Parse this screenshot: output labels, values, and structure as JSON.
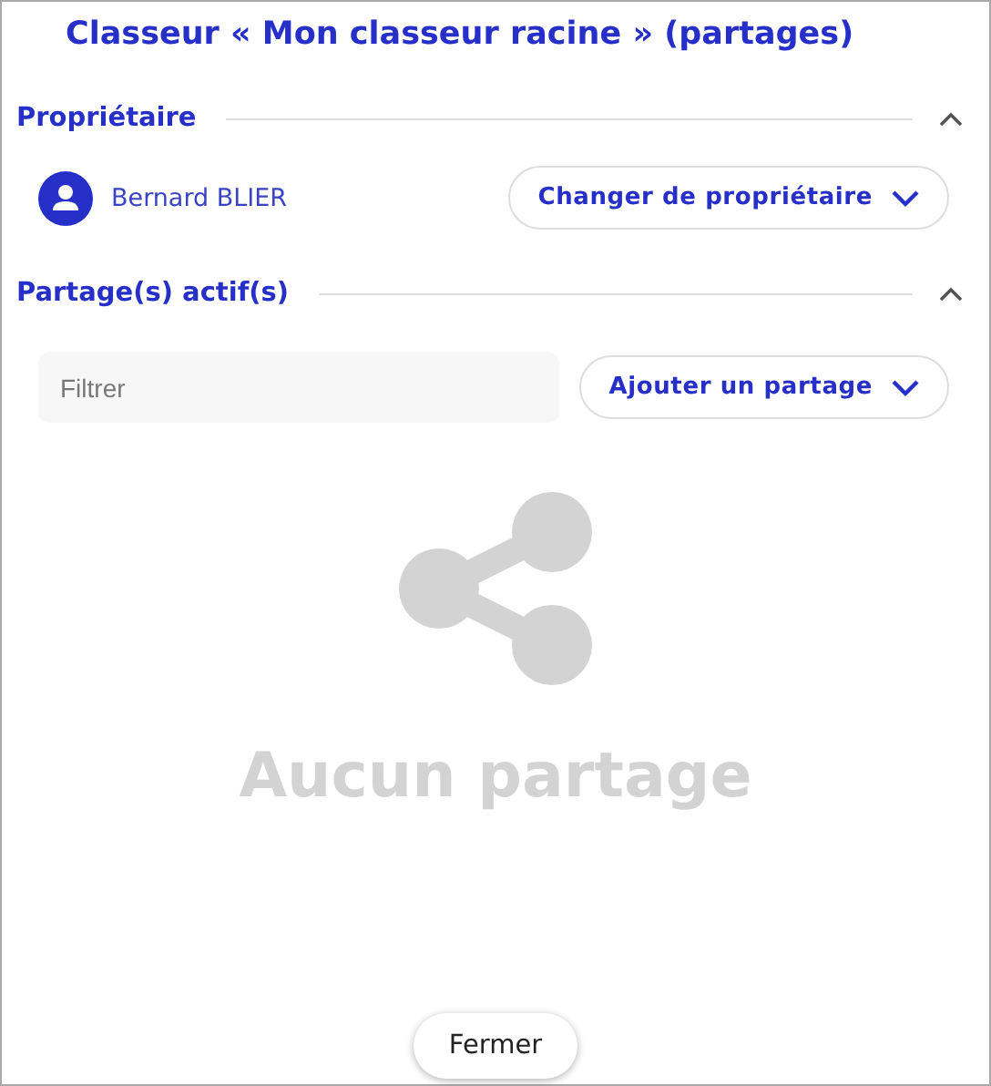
{
  "dialog": {
    "title": "Classeur « Mon classeur racine » (partages)"
  },
  "owner_section": {
    "title": "Propriétaire",
    "expanded": true,
    "owner_name": "Bernard BLIER",
    "change_button": "Changer de propriétaire"
  },
  "shares_section": {
    "title": "Partage(s) actif(s)",
    "expanded": true,
    "filter": {
      "placeholder": "Filtrer"
    },
    "add_button": "Ajouter un partage",
    "empty_message": "Aucun partage"
  },
  "buttons": [
    "Fermer"
  ]
}
